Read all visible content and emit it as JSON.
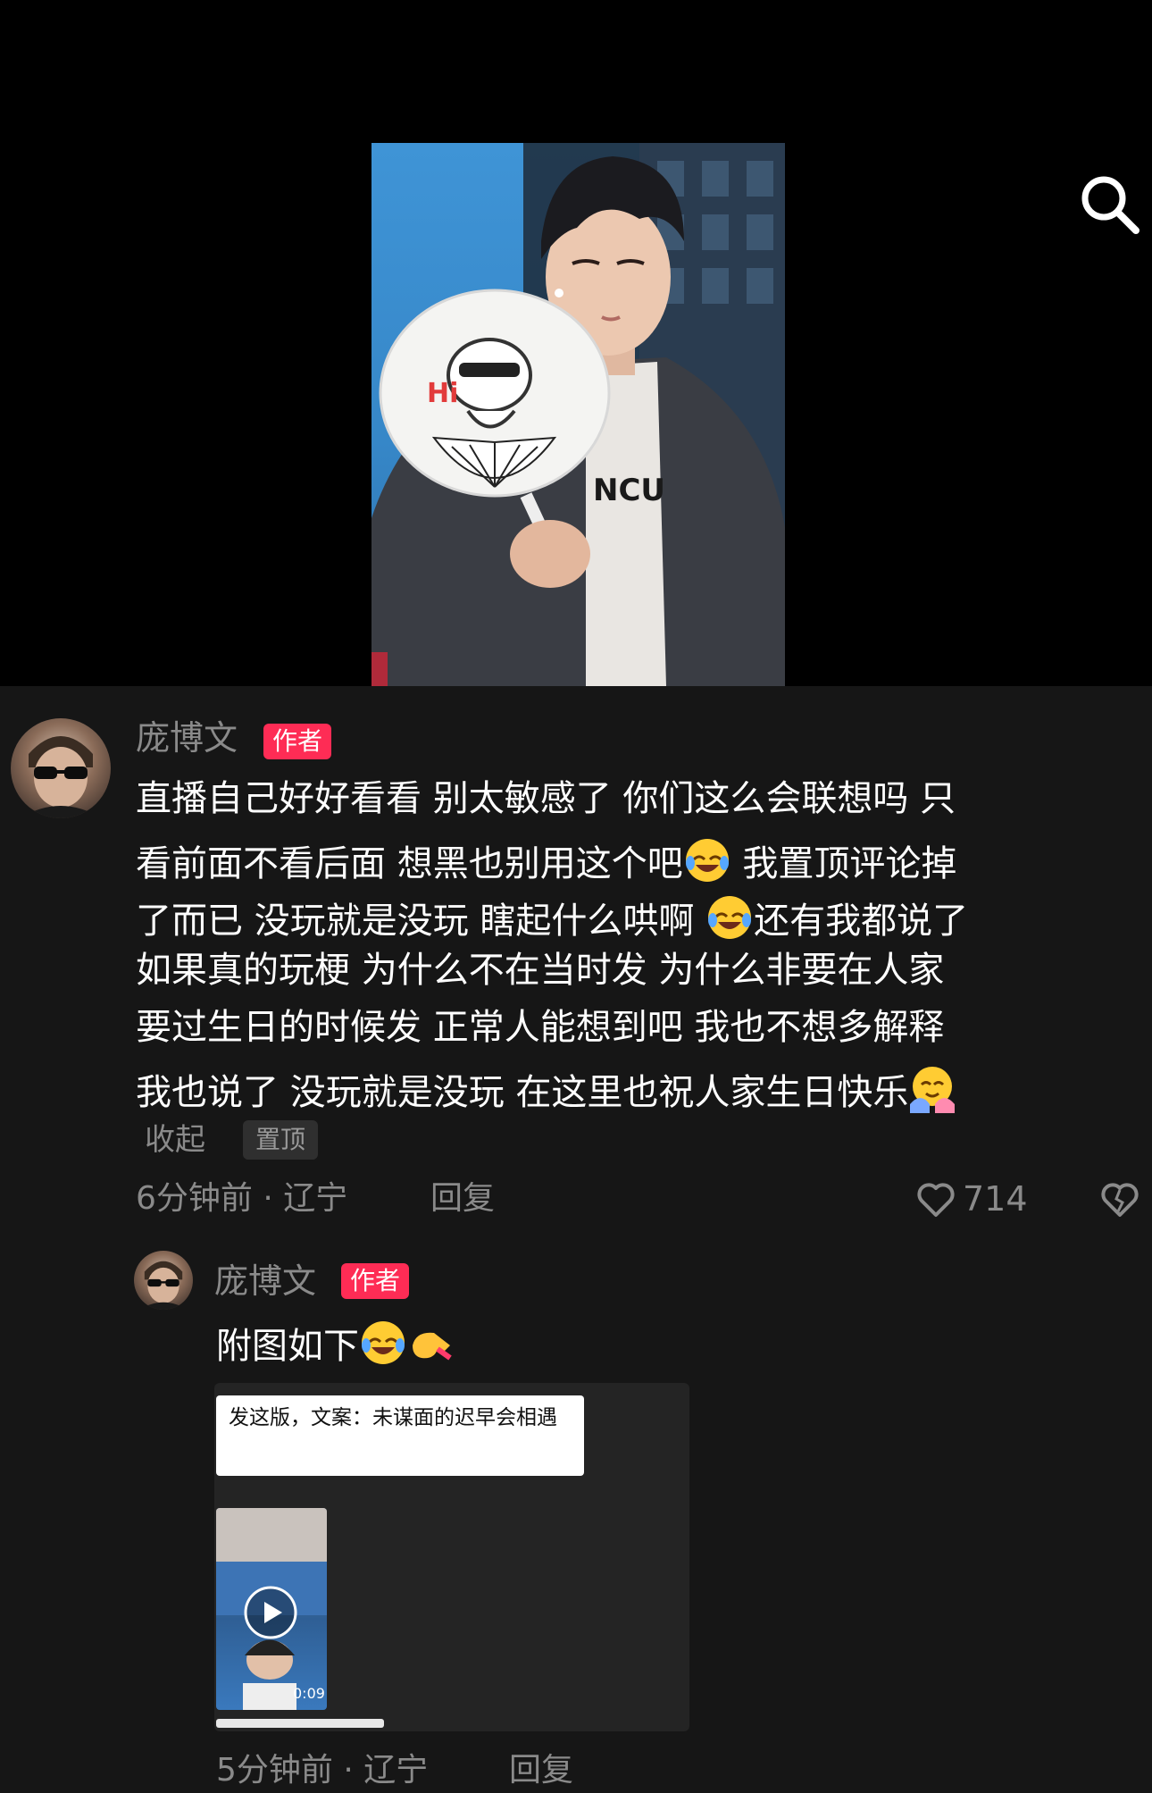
{
  "header": {
    "search_icon": "search-icon"
  },
  "video": {
    "fan_text": "Hi",
    "shirt_text": "NCU"
  },
  "pinned_comment": {
    "username": "庞博文",
    "badge": "作者",
    "lines": [
      "直播自己好好看看 别太敏感了 你们这么会联想吗 只",
      "看前面不看后面 想黑也别用这个吧",
      " 我置顶评论掉",
      "了而已 没玩就是没玩 瞎起什么哄啊 ",
      "还有我都说了",
      "如果真的玩梗 为什么不在当时发 为什么非要在人家",
      "要过生日的时候发 正常人能想到吧 我也不想多解释",
      "我也说了 没玩就是没玩 在这里也祝人家生日快乐"
    ],
    "collapse_label": "收起",
    "pinned_label": "置顶",
    "time": "6分钟前 · 辽宁",
    "reply_label": "回复",
    "likes": "714"
  },
  "reply_comment": {
    "username": "庞博文",
    "badge": "作者",
    "text": "附图如下",
    "attachment": {
      "caption": "发这版，文案：未谋面的迟早会相遇",
      "duration": "0:09"
    },
    "time": "5分钟前 · 辽宁",
    "reply_label": "回复"
  },
  "colors": {
    "badge": "#fe2c55",
    "panel": "#161616",
    "meta": "#8a8a8a"
  }
}
